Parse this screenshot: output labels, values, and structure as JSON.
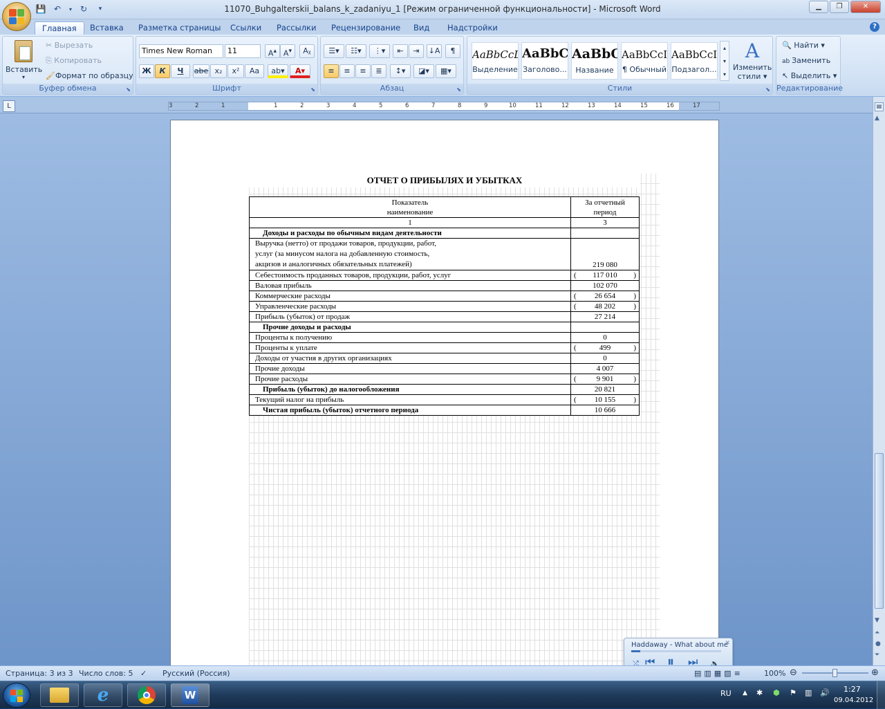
{
  "window": {
    "title": "11070_Buhgalterskii_balans_k_zadaniyu_1 [Режим ограниченной функциональности] - Microsoft Word",
    "help": "?"
  },
  "tabs": [
    "Главная",
    "Вставка",
    "Разметка страницы",
    "Ссылки",
    "Рассылки",
    "Рецензирование",
    "Вид",
    "Надстройки"
  ],
  "clipboard": {
    "paste": "Вставить",
    "cut": "Вырезать",
    "copy": "Копировать",
    "format_painter": "Формат по образцу",
    "label": "Буфер обмена"
  },
  "font": {
    "name": "Times New Roman",
    "size": "11",
    "bold": "Ж",
    "italic": "К",
    "underline": "Ч",
    "strike": "abe",
    "subscript": "x₂",
    "superscript": "x²",
    "case": "Aa",
    "label": "Шрифт"
  },
  "paragraph": {
    "label": "Абзац",
    "pilcrow": "¶"
  },
  "styles": {
    "label": "Стили",
    "items": [
      {
        "preview": "AaBbCcL",
        "name": "Выделение"
      },
      {
        "preview": "AaBbC",
        "name": "Заголово..."
      },
      {
        "preview": "AaBbC",
        "name": "Название"
      },
      {
        "preview": "AaBbCcI",
        "name": "¶ Обычный"
      },
      {
        "preview": "AaBbCcI",
        "name": "Подзагол..."
      }
    ],
    "change_line1": "Изменить",
    "change_line2": "стили"
  },
  "editing": {
    "label": "Редактирование",
    "find": "Найти",
    "replace": "Заменить",
    "select": "Выделить"
  },
  "ruler_numbers": [
    "3",
    "2",
    "1",
    "1",
    "2",
    "3",
    "4",
    "5",
    "6",
    "7",
    "8",
    "9",
    "10",
    "11",
    "12",
    "13",
    "14",
    "15",
    "16",
    "17"
  ],
  "report": {
    "title": "ОТЧЕТ О ПРИБЫЛЯХ И УБЫТКАХ",
    "header_col1_line1": "Показатель",
    "header_col1_line2": "наименование",
    "header_col2_line1": "За отчетный",
    "header_col2_line2": "период",
    "colnum1": "1",
    "colnum2": "3",
    "rows": [
      {
        "label": "Доходы и расходы по обычным видам деятельности",
        "value": "",
        "bold": true
      },
      {
        "label": "Выручка (нетто) от продажи товаров, продукции, работ,",
        "label2": "услуг (за минусом налога на добавленную стоимость,",
        "label3": "акцизов и аналогичных обязательных платежей)",
        "value": "219 080"
      },
      {
        "label": "Себестоимость проданных товаров, продукции, работ, услуг",
        "value": "117 010",
        "paren": true
      },
      {
        "label": "Валовая прибыль",
        "value": "102 070"
      },
      {
        "label": "Коммерческие расходы",
        "value": "26 654",
        "paren": true
      },
      {
        "label": "Управленческие расходы",
        "value": "48 202",
        "paren": true
      },
      {
        "label": "Прибыль (убыток) от продаж",
        "value": "27 214"
      },
      {
        "label": "Прочие доходы и расходы",
        "value": "",
        "bold": true
      },
      {
        "label": "Проценты к получению",
        "value": "0"
      },
      {
        "label": "Проценты к уплате",
        "value": "499",
        "paren": true
      },
      {
        "label": "Доходы от участия в других организациях",
        "value": "0"
      },
      {
        "label": "Прочие доходы",
        "value": "4 007"
      },
      {
        "label": "Прочие расходы",
        "value": "9 901",
        "paren": true
      },
      {
        "label": "Прибыль (убыток) до налогообложения",
        "value": "20 821",
        "bold": true
      },
      {
        "label": "Текущий налог на прибыль",
        "value": "10 155",
        "paren": true
      },
      {
        "label": "Чистая прибыль (убыток) отчетного периода",
        "value": "10 666",
        "bold": true
      }
    ]
  },
  "media": {
    "song": "Haddaway - What about me",
    "progress": 0.1
  },
  "status": {
    "page": "Страница: 3 из 3",
    "words": "Число слов: 5",
    "language": "Русский (Россия)",
    "zoom": "100%"
  },
  "taskbar": {
    "lang": "RU",
    "time": "1:27",
    "date": "09.04.2012"
  }
}
